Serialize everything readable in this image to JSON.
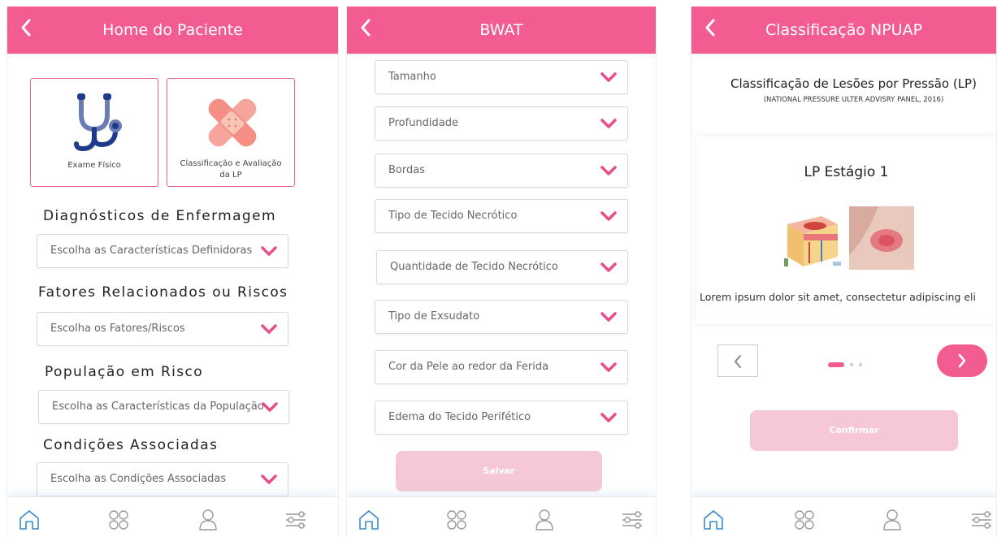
{
  "colors": {
    "accent": "#f25c91",
    "accent_light": "#f6c7d6",
    "chevron": "#e84f8a"
  },
  "screen1": {
    "title": "Home do Paciente",
    "cards": [
      {
        "label": "Exame Físico",
        "icon": "stethoscope-icon"
      },
      {
        "label_line1": "Classificação e Avaliação",
        "label_line2": "da LP",
        "icon": "bandage-icon"
      }
    ],
    "sections": [
      {
        "title": "Diagnósticos de Enfermagem",
        "select": "Escolha as Características Definidoras"
      },
      {
        "title": "Fatores Relacionados ou Riscos",
        "select": "Escolha os Fatores/Riscos"
      },
      {
        "title": "População em Risco",
        "select": "Escolha as Características da População"
      },
      {
        "title": "Condições Associadas",
        "select": "Escolha as Condições Associadas"
      }
    ]
  },
  "screen2": {
    "title": "BWAT",
    "fields": [
      "Tamanho",
      "Profundidade",
      "Bordas",
      "Tipo de Tecido Necrótico",
      "Quantidade de Tecido Necrótico",
      "Tipo de Exsudato",
      "Cor da Pele ao redor da Ferida",
      "Edema do Tecido Perifético"
    ],
    "save_label": "Salvar"
  },
  "screen3": {
    "title": "Classificação NPUAP",
    "heading": "Classificação de Lesões por Pressão (LP)",
    "subheading": "(NATIONAL PRESSURE ULTER ADVISRY PANEL, 2016)",
    "slide_title": "LP Estágio 1",
    "slide_text": "Lorem ipsum dolor sit amet, consectetur adipiscing eli",
    "confirm_label": "Confirmar"
  }
}
